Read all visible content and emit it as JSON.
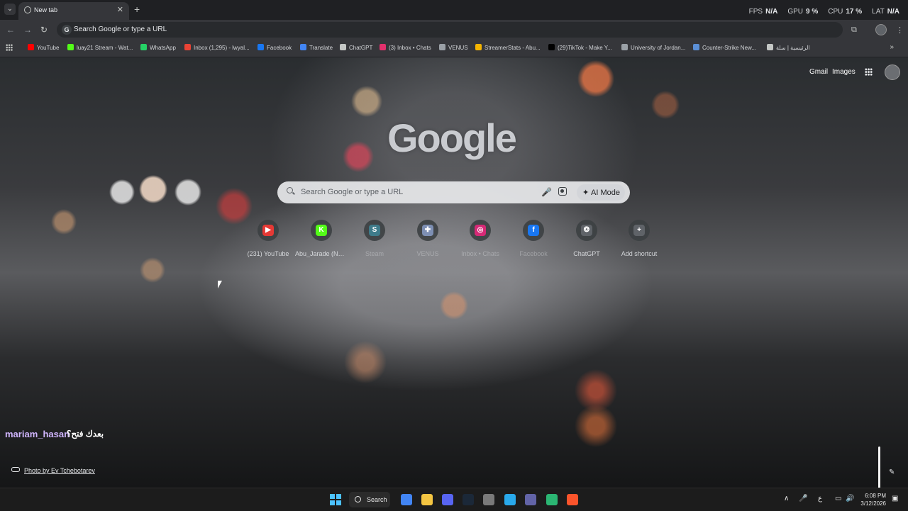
{
  "tabstrip": {
    "tab_title": "New tab",
    "new_tab_symbol": "+",
    "close_symbol": "✕",
    "menu_symbol": "⌄"
  },
  "overlay_stats": [
    {
      "label": "FPS",
      "value": "N/A"
    },
    {
      "label": "GPU",
      "value": "9 %"
    },
    {
      "label": "CPU",
      "value": "17 %"
    },
    {
      "label": "LAT",
      "value": "N/A"
    }
  ],
  "toolbar": {
    "back": "←",
    "forward": "→",
    "reload": "↻",
    "omnibox_placeholder": "Search Google or type a URL",
    "omnibox_icon": "G",
    "extensions": "⧉",
    "menu": "⋮"
  },
  "bookmarks": [
    {
      "label": "YouTube",
      "icon": "youtube-icon",
      "color": "#ff0000"
    },
    {
      "label": "luay21 Stream - Wat...",
      "icon": "kick-icon",
      "color": "#53fc18"
    },
    {
      "label": "WhatsApp",
      "icon": "whatsapp-icon",
      "color": "#25d366"
    },
    {
      "label": "Inbox (1,295) - lwyal...",
      "icon": "gmail-icon",
      "color": "#ea4335"
    },
    {
      "label": "Facebook",
      "icon": "facebook-icon",
      "color": "#1877f2"
    },
    {
      "label": "Translate",
      "icon": "translate-icon",
      "color": "#4285f4"
    },
    {
      "label": "ChatGPT",
      "icon": "chatgpt-icon",
      "color": "#c4c7c5"
    },
    {
      "label": "(3) Inbox • Chats",
      "icon": "instagram-icon",
      "color": "#e1306c"
    },
    {
      "label": "VENUS",
      "icon": "venus-icon",
      "color": "#9aa0a6"
    },
    {
      "label": "StreamerStats - Abu...",
      "icon": "streamerstats-icon",
      "color": "#f4b400"
    },
    {
      "label": "(29)TikTok - Make Y...",
      "icon": "tiktok-icon",
      "color": "#000000"
    },
    {
      "label": "University of Jordan...",
      "icon": "university-icon",
      "color": "#9aa0a6"
    },
    {
      "label": "Counter-Strike New...",
      "icon": "counterstrike-icon",
      "color": "#5b8fd6"
    },
    {
      "label": "الرئيسية | سلة",
      "icon": "salla-icon",
      "color": "#c4c7c5"
    }
  ],
  "ntp": {
    "gmail": "Gmail",
    "images": "Images",
    "logo": "Google",
    "search_placeholder": "Search Google or type a URL",
    "ai_mode": "AI Mode",
    "ai_icon": "✦",
    "mic_icon": "🎤",
    "shortcuts": [
      {
        "label": "(231) YouTube",
        "glyph": "▶",
        "color": "#e53935",
        "faded": false
      },
      {
        "label": "Abu_Jarade (Nab...",
        "glyph": "K",
        "color": "#53fc18",
        "faded": false
      },
      {
        "label": "Steam",
        "glyph": "S",
        "color": "#3e7b8a",
        "faded": true
      },
      {
        "label": "VENUS",
        "glyph": "✚",
        "color": "#7d8fb3",
        "faded": true
      },
      {
        "label": "Inbox • Chats",
        "glyph": "◎",
        "color": "#d62976",
        "faded": true
      },
      {
        "label": "Facebook",
        "glyph": "f",
        "color": "#1877f2",
        "faded": true
      },
      {
        "label": "ChatGPT",
        "glyph": "❂",
        "color": "#5f6368",
        "faded": false
      },
      {
        "label": "Add shortcut",
        "glyph": "+",
        "color": "#5f6368",
        "faded": false
      }
    ],
    "chat_user": "mariam_hasan",
    "chat_message": "بعدك فتح؟",
    "photo_credit": "Photo by Ev Tchebotarev",
    "customize_icon": "✎"
  },
  "taskbar": {
    "search_label": "Search",
    "apps": [
      {
        "name": "chrome-icon",
        "color": "#4285f4"
      },
      {
        "name": "file-explorer-icon",
        "color": "#f4c542"
      },
      {
        "name": "discord-icon",
        "color": "#5865f2"
      },
      {
        "name": "steam-icon",
        "color": "#1b2838"
      },
      {
        "name": "notepad-icon",
        "color": "#7a7a7a"
      },
      {
        "name": "telegram-icon",
        "color": "#29a9eb"
      },
      {
        "name": "teams-icon",
        "color": "#6264a7"
      },
      {
        "name": "game-app-icon",
        "color": "#2bb673"
      },
      {
        "name": "brave-icon",
        "color": "#fb542b"
      }
    ],
    "tray_chevron": "∧",
    "mic": "🎤",
    "lang": "ع",
    "time": "6:08 PM",
    "date": "3/12/2026"
  }
}
